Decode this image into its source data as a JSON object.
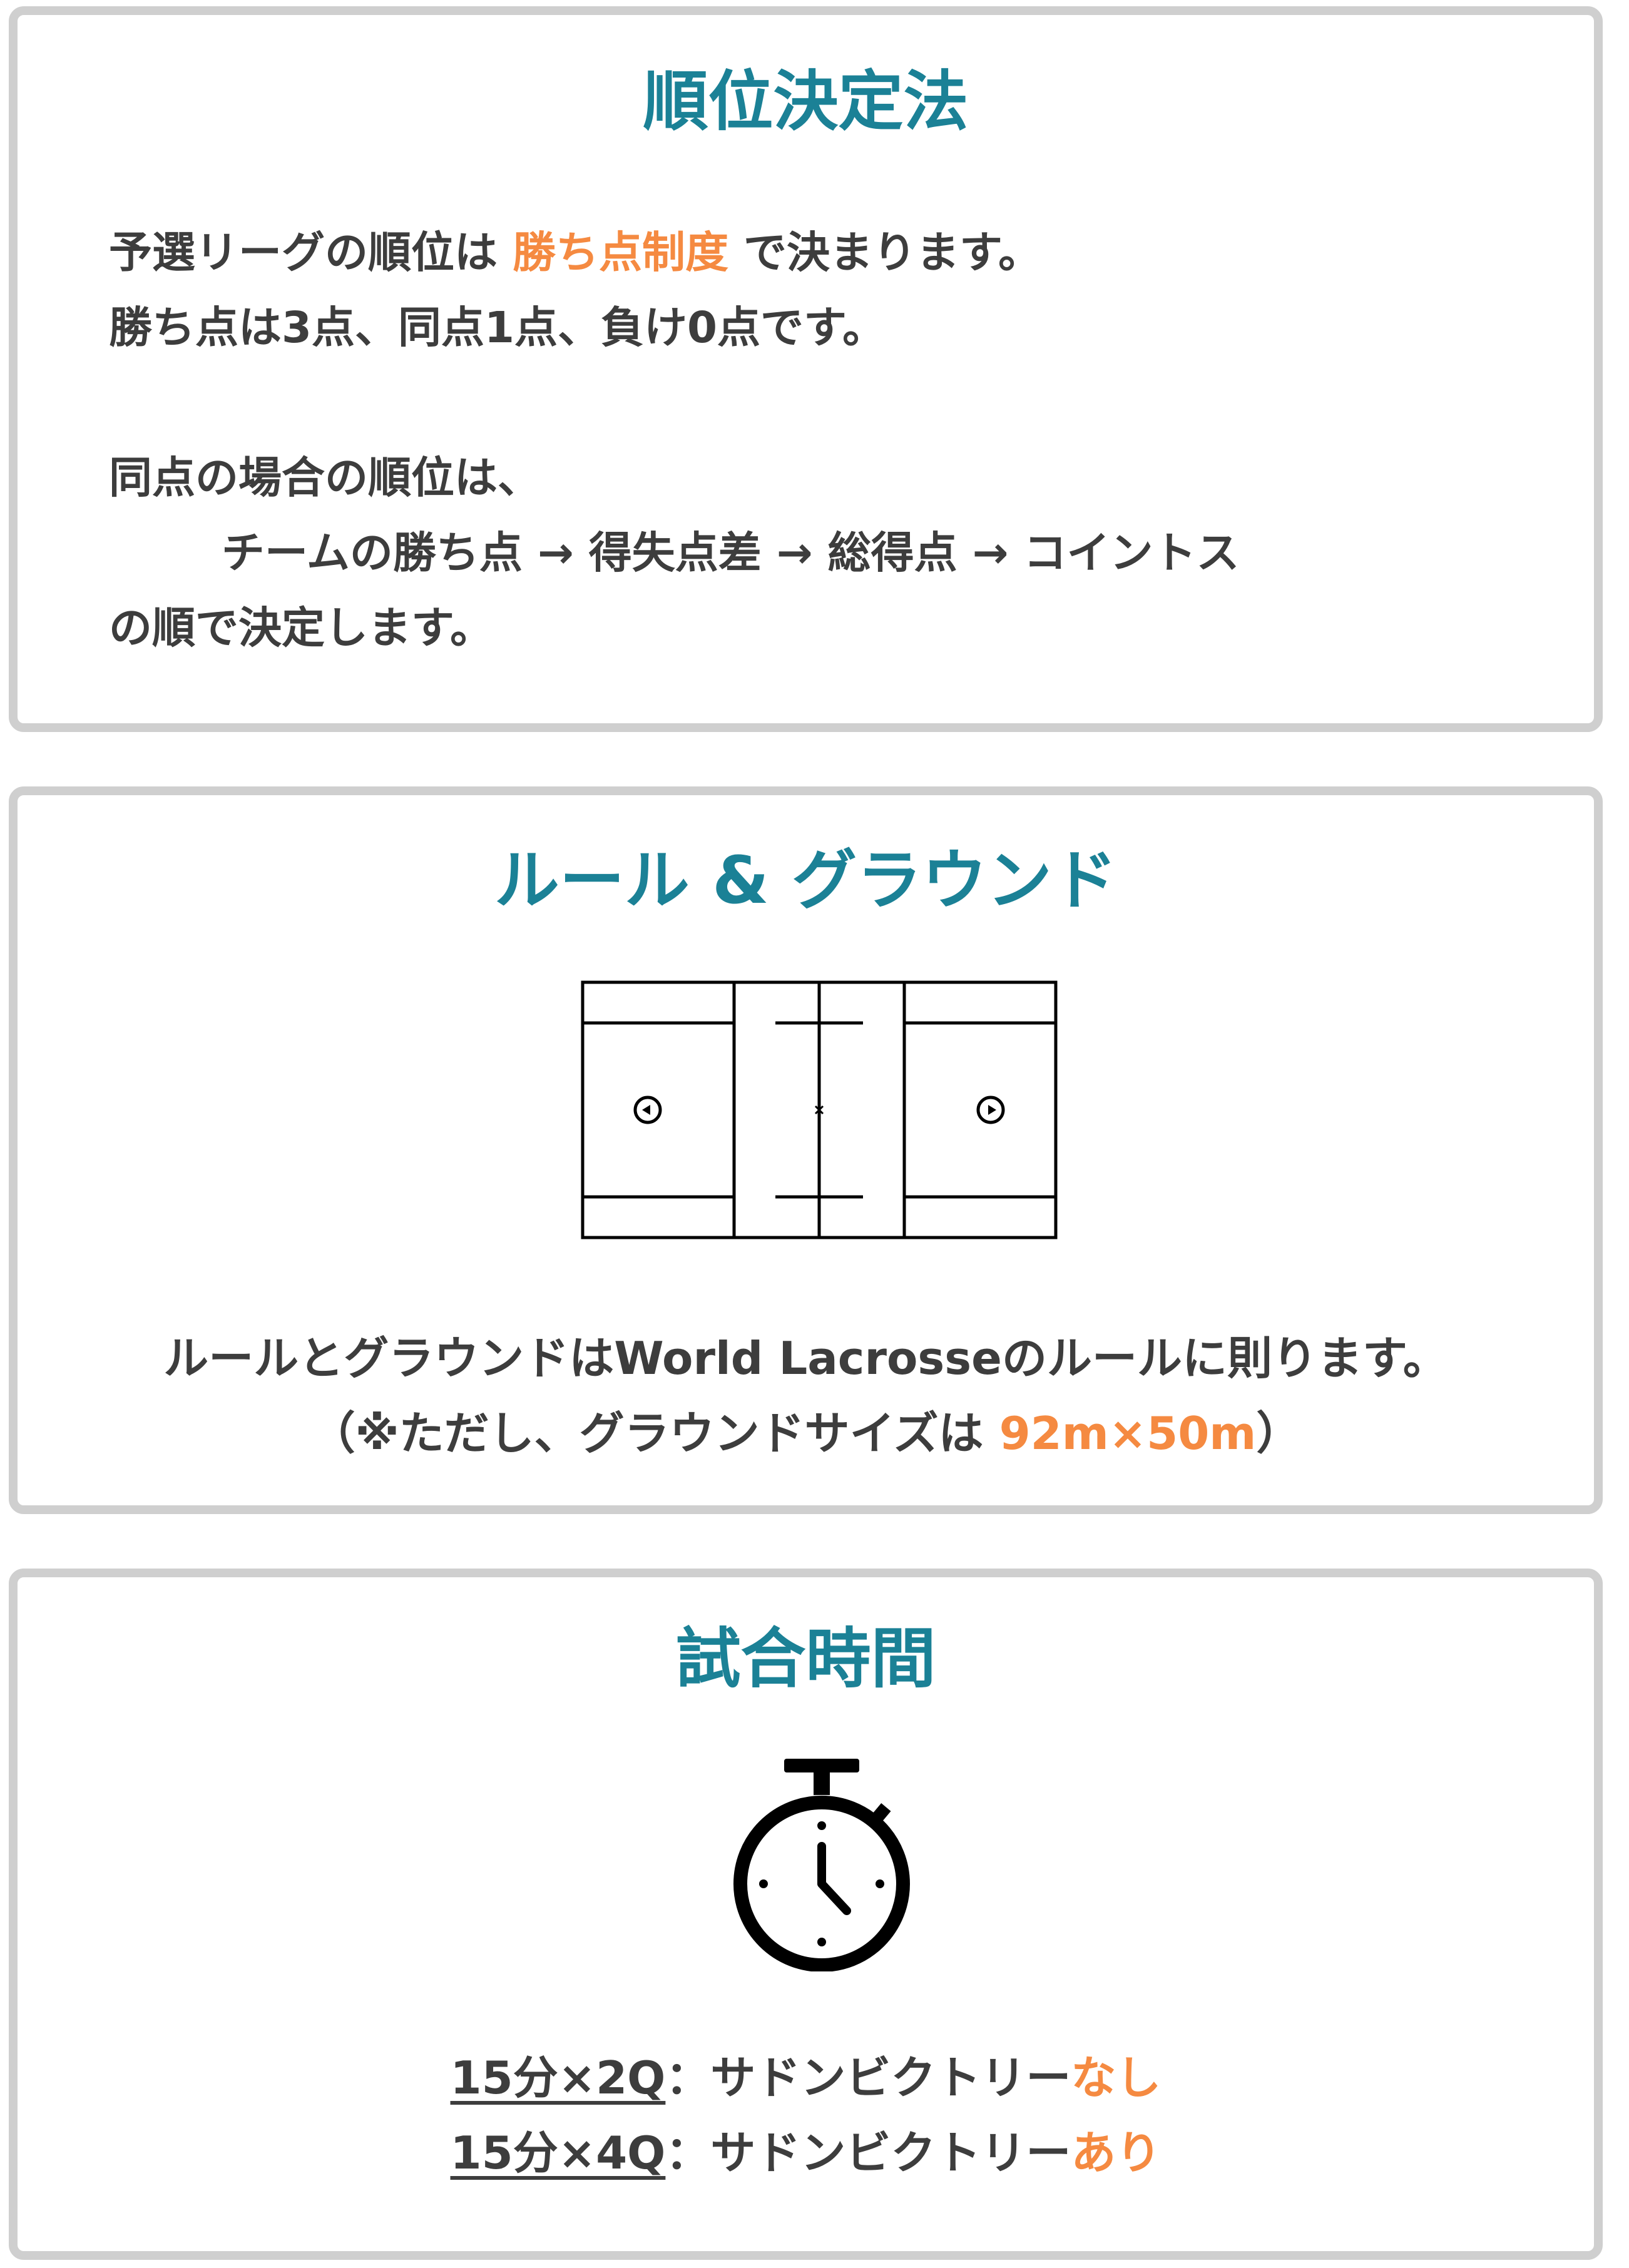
{
  "ranking": {
    "title": "順位決定法",
    "line1_prefix": "予選リーグの順位は ",
    "line1_highlight": "勝ち点制度",
    "line1_suffix": " で決まります。",
    "line2": "勝ち点は3点、同点1点、負け0点です。",
    "line3": "同点の場合の順位は、",
    "line4": "チームの勝ち点 → 得失点差 → 総得点 → コイントス",
    "line5": "の順で決定します。"
  },
  "rules": {
    "title": "ルール & グラウンド",
    "field_icon": "lacrosse-field-diagram",
    "line1": "ルールとグラウンドはWorld Lacrosseのルールに則ります。",
    "line2_prefix": "（※ただし、グラウンドサイズは ",
    "line2_highlight": "92m×50m",
    "line2_suffix": "）"
  },
  "time": {
    "title": "試合時間",
    "icon": "stopwatch-icon",
    "rows": [
      {
        "format": "15分×2Q",
        "sep": "：",
        "label": "サドンビクトリー",
        "value": "なし"
      },
      {
        "format": "15分×4Q",
        "sep": "：",
        "label": "サドンビクトリー",
        "value": "あり"
      }
    ]
  },
  "colors": {
    "title": "#1b8196",
    "accent": "#f58a41",
    "text": "#3d3d3d",
    "border": "#cfcfcf"
  }
}
